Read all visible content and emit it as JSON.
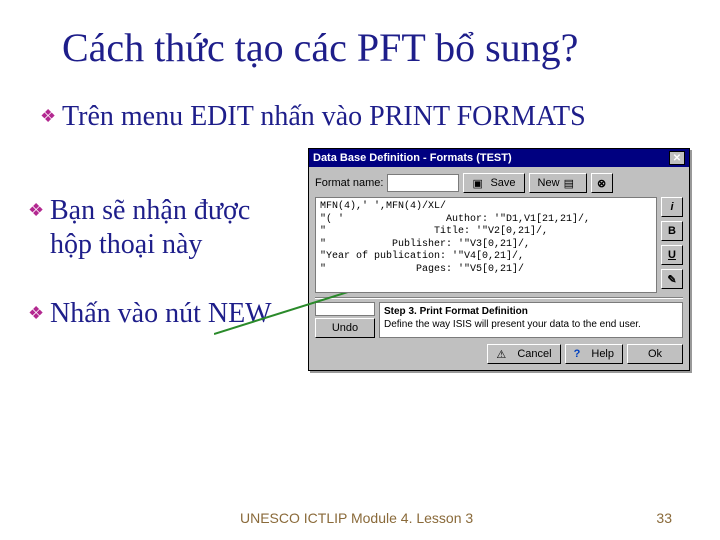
{
  "title": "Cách thức tạo các PFT bổ sung?",
  "bullets": {
    "b1": "Trên menu EDIT nhấn vào PRINT FORMATS",
    "b2": "Bạn sẽ nhận được hộp thoại này",
    "b3": "Nhấn vào nút NEW"
  },
  "dialog": {
    "title": "Data Base Definition - Formats (TEST)",
    "close": "✕",
    "format_label": "Format name:",
    "format_value": "",
    "save": "Save",
    "new": "New",
    "code": "MFN(4),' ',MFN(4)/XL/\n\"( '                 Author: '\"D1,V1[21,21]/,\n\"                  Title: '\"V2[0,21]/,\n\"           Publisher: '\"V3[0,21]/,\n\"Year of publication: '\"V4[0,21]/,\n\"               Pages: '\"V5[0,21]/",
    "btn_i": "i",
    "btn_b": "B",
    "btn_u": "U",
    "btn_brush": "✎",
    "undo": "Undo",
    "step_title": "Step 3. Print Format Definition",
    "step_desc": "Define the way ISIS will present your data to the end user.",
    "cancel": "Cancel",
    "help": "Help",
    "ok": "Ok"
  },
  "footer": {
    "text": "UNESCO ICTLIP Module 4. Lesson 3",
    "page": "33"
  },
  "icons": {
    "diamond": "❖",
    "disk": "▣",
    "doc": "▤",
    "question": "?",
    "warn": "⚠",
    "gauge": "◐"
  }
}
